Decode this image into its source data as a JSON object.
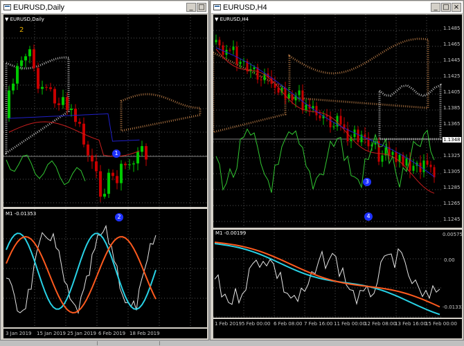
{
  "windows": [
    {
      "title": "EURUSD,Daily",
      "chart_label": "EURUSD,Daily",
      "indicator_label": "M1 -0.01353",
      "buttons": [
        "_",
        "□"
      ],
      "date_labels": [
        "3 Jan 2019",
        "15 Jan 2019",
        "25 Jan 2019",
        "6 Feb 2019",
        "18 Feb 2019"
      ],
      "top_mark": "2",
      "markers": [
        "1",
        "2"
      ]
    },
    {
      "title": "EURUSD,H4",
      "chart_label": "EURUSD,H4",
      "indicator_label": "M1 -0.00199",
      "buttons": [
        "_",
        "□",
        "×"
      ],
      "price_labels": [
        "1.1485",
        "1.1465",
        "1.1445",
        "1.1425",
        "1.1405",
        "1.1385",
        "1.1365",
        "1.1348",
        "1.1325",
        "1.1305",
        "1.1285",
        "1.1265",
        "1.1245"
      ],
      "current_price": "1.1348",
      "indicator_scale": [
        "0.00575",
        "0.00",
        "-0.01332"
      ],
      "date_labels": [
        "1 Feb 2019",
        "5 Feb 00:00",
        "6 Feb 08:00",
        "7 Feb 16:00",
        "11 Feb 00:00",
        "12 Feb 08:00",
        "13 Feb 16:00",
        "15 Feb 00:00"
      ],
      "markers": [
        "3",
        "4"
      ]
    }
  ],
  "colors": {
    "bull": "#00c800",
    "bear": "#c80000",
    "kijun": "#2020c8",
    "tenkan": "#c81e1e",
    "chikou": "#32c832",
    "cloud_a": "#e0e0e0",
    "cloud_b": "#d28c50",
    "ind_white": "#e6e6e6",
    "ind_cyan": "#28d2e6",
    "ind_orange": "#ff5a1e",
    "marker": "#1e32ff"
  }
}
